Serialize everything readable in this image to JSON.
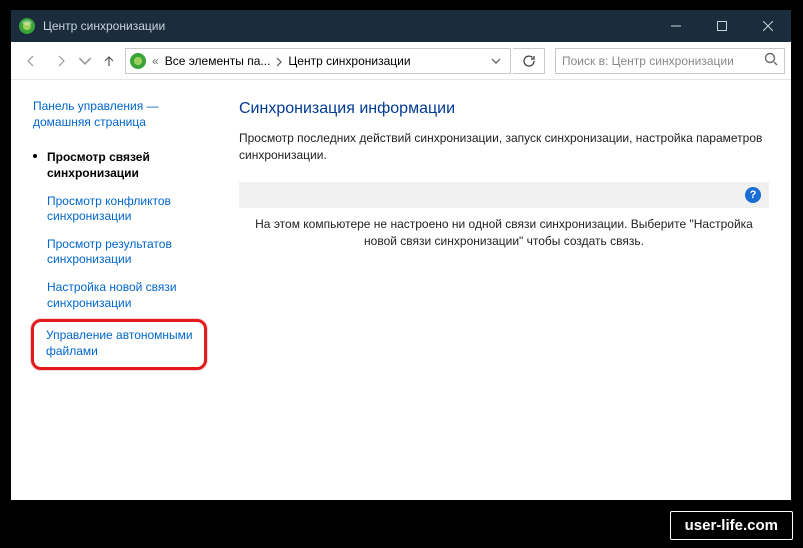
{
  "titlebar": {
    "title": "Центр синхронизации"
  },
  "breadcrumb": {
    "prefix": "«",
    "seg1": "Все элементы па...",
    "seg2": "Центр синхронизации"
  },
  "search": {
    "placeholder": "Поиск в: Центр синхронизации"
  },
  "sidebar": {
    "home": "Панель управления — домашняя страница",
    "items": [
      {
        "label": "Просмотр связей синхронизации",
        "active": true
      },
      {
        "label": "Просмотр конфликтов синхронизации"
      },
      {
        "label": "Просмотр результатов синхронизации"
      },
      {
        "label": "Настройка новой связи синхронизации"
      },
      {
        "label": "Управление автономными файлами",
        "highlighted": true
      }
    ]
  },
  "content": {
    "heading": "Синхронизация информации",
    "paragraph": "Просмотр последних действий синхронизации, запуск синхронизации, настройка параметров синхронизации.",
    "info": "На этом компьютере не настроено ни одной связи синхронизации. Выберите \"Настройка новой связи синхронизации\" чтобы создать связь."
  },
  "watermark": "user-life.com"
}
